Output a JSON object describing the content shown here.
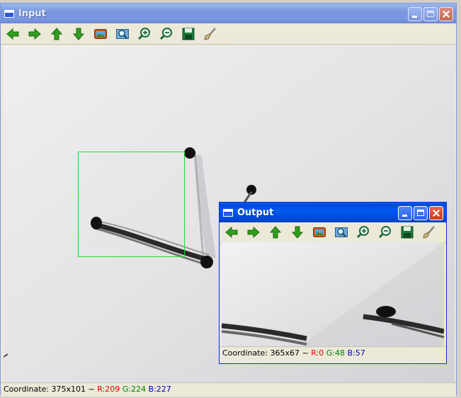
{
  "input_window": {
    "title": "Input",
    "toolbar": [
      "arrow-left-icon",
      "arrow-right-icon",
      "arrow-up-icon",
      "arrow-down-icon",
      "image-icon",
      "zoom-region-icon",
      "zoom-in-icon",
      "zoom-out-icon",
      "save-icon",
      "brush-icon"
    ],
    "status": {
      "prefix": "Coordinate: 375x101 ~ ",
      "r": "R:209",
      "g": "G:224",
      "b": "B:227"
    }
  },
  "output_window": {
    "title": "Output",
    "toolbar": [
      "arrow-left-icon",
      "arrow-right-icon",
      "arrow-up-icon",
      "arrow-down-icon",
      "image-icon",
      "zoom-region-icon",
      "zoom-in-icon",
      "zoom-out-icon",
      "save-icon",
      "brush-icon"
    ],
    "status": {
      "prefix": "Coordinate: 365x67 ~ ",
      "r": "R:0",
      "g": "G:48",
      "b": "B:57"
    }
  },
  "colors": {
    "active_title": "#0050e0",
    "inactive_title": "#7a96df",
    "selection": "#22dd22",
    "arrow_green": "#2f9e1e"
  }
}
